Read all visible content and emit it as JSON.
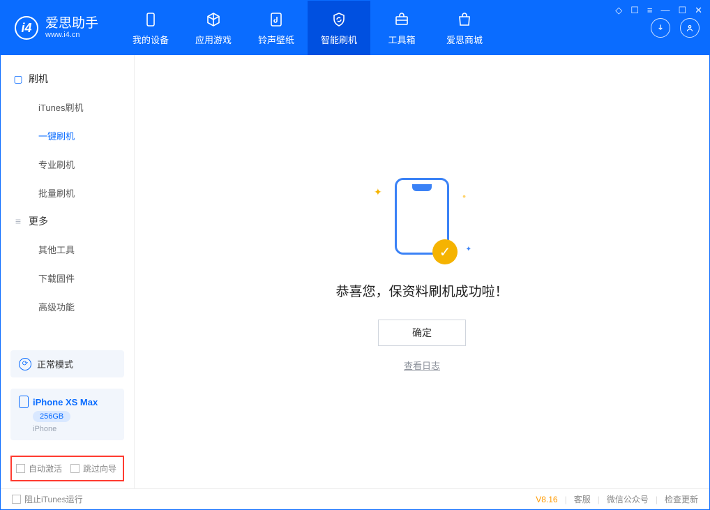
{
  "logo": {
    "title": "爱思助手",
    "subtitle": "www.i4.cn"
  },
  "topTabs": {
    "device": "我的设备",
    "apps": "应用游戏",
    "ringtone": "铃声壁纸",
    "flash": "智能刷机",
    "toolbox": "工具箱",
    "store": "爱思商城"
  },
  "sidebar": {
    "sectionFlash": "刷机",
    "itunes": "iTunes刷机",
    "oneclick": "一键刷机",
    "pro": "专业刷机",
    "batch": "批量刷机",
    "sectionMore": "更多",
    "other": "其他工具",
    "firmware": "下载固件",
    "advanced": "高级功能"
  },
  "mode": {
    "label": "正常模式"
  },
  "device": {
    "name": "iPhone XS Max",
    "storage": "256GB",
    "type": "iPhone"
  },
  "options": {
    "autoActivate": "自动激活",
    "skipGuide": "跳过向导"
  },
  "main": {
    "successText": "恭喜您，保资料刷机成功啦！",
    "okLabel": "确定",
    "viewLog": "查看日志"
  },
  "footer": {
    "blockItunes": "阻止iTunes运行",
    "version": "V8.16",
    "service": "客服",
    "wechat": "微信公众号",
    "update": "检查更新"
  }
}
